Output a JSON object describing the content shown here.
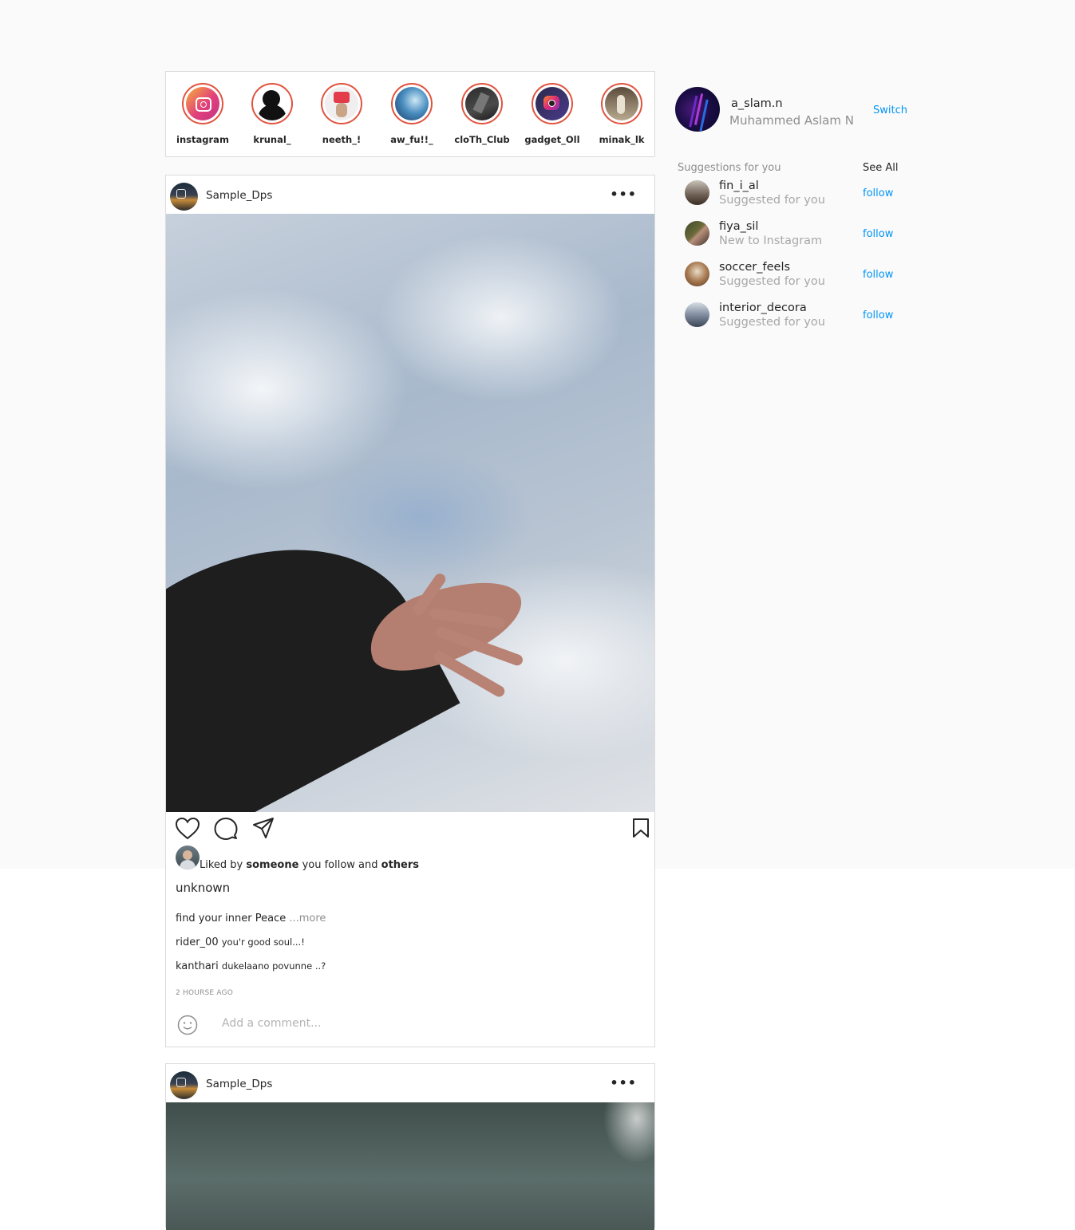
{
  "stories": [
    {
      "name": "instagram"
    },
    {
      "name": "krunal_"
    },
    {
      "name": "neeth_!"
    },
    {
      "name": "aw_fu!!_"
    },
    {
      "name": "cloTh_Club"
    },
    {
      "name": "gadget_Oll"
    },
    {
      "name": "minak_lk"
    }
  ],
  "post1": {
    "username": "Sample_Dps",
    "more_icon": "•••",
    "liked_prefix": "Liked by ",
    "liked_someone": "someone",
    "liked_middle": " you follow and ",
    "liked_others": "others",
    "location": "unknown",
    "caption": "find your inner Peace ",
    "caption_more": "...more",
    "comments": [
      {
        "user": "rider_00",
        "text": "you'r good soul...!"
      },
      {
        "user": "kanthari",
        "text": "dukelaano povunne ..?"
      }
    ],
    "time": "2 HOURSE AGO",
    "comment_placeholder": "Add a comment..."
  },
  "post2": {
    "username": "Sample_Dps",
    "more_icon": "•••"
  },
  "me": {
    "username": "a_slam.n",
    "full_name": "Muhammed Aslam N",
    "switch_label": "Switch"
  },
  "suggestions": {
    "title": "Suggestions for you",
    "see_all": "See All",
    "items": [
      {
        "user": "fin_i_al",
        "sub": "Suggested for you",
        "action": "follow"
      },
      {
        "user": "fiya_sil",
        "sub": "New to Instagram",
        "action": "follow"
      },
      {
        "user": "soccer_feels",
        "sub": "Suggested for you",
        "action": "follow"
      },
      {
        "user": "interior_decora",
        "sub": "Suggested for you",
        "action": "follow"
      }
    ]
  },
  "colors": {
    "story_ring": "#e0533e",
    "link_blue": "#0095f6",
    "border": "#dbdbdb",
    "page_bg": "#fafafa"
  }
}
